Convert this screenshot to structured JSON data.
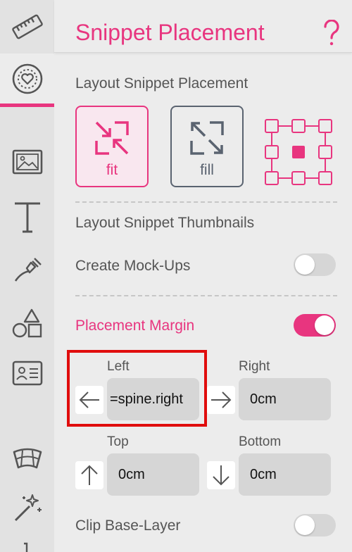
{
  "header": {
    "title": "Snippet Placement"
  },
  "sections": {
    "layout_placement": "Layout Snippet Placement",
    "layout_thumbnails": "Layout Snippet Thumbnails",
    "create_mockups": "Create Mock-Ups",
    "placement_margin": "Placement Margin",
    "clip_base_layer": "Clip Base-Layer"
  },
  "placement_modes": [
    {
      "label": "fit",
      "selected": true
    },
    {
      "label": "fill",
      "selected": false
    }
  ],
  "toggles": {
    "create_mockups": false,
    "placement_margin": true,
    "clip_base_layer": false
  },
  "margins": {
    "left": {
      "label": "Left",
      "value": "=spine.right"
    },
    "right": {
      "label": "Right",
      "value": "0cm"
    },
    "top": {
      "label": "Top",
      "value": "0cm"
    },
    "bottom": {
      "label": "Bottom",
      "value": "0cm"
    }
  },
  "rail_icons": [
    "ruler-icon",
    "heart-badge-icon",
    "image-icon",
    "text-icon",
    "pen-tool-icon",
    "shapes-icon",
    "id-card-icon",
    "panorama-icon",
    "magic-wand-icon"
  ],
  "colors": {
    "accent": "#e8357f",
    "highlight": "#e00d0d",
    "icon": "#555555"
  }
}
